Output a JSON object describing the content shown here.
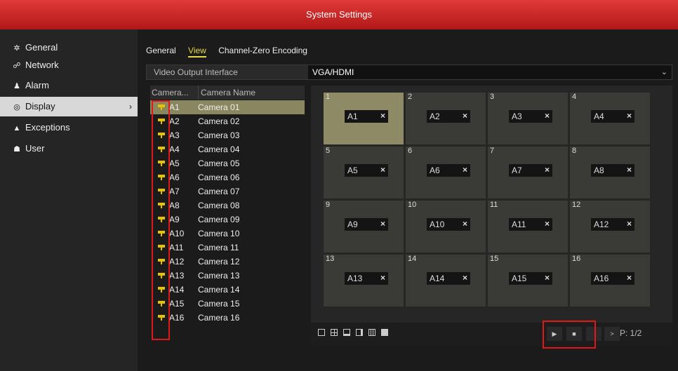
{
  "window": {
    "title": "System Settings"
  },
  "sidebar": {
    "items": [
      {
        "label": "General",
        "icon": "gear-icon"
      },
      {
        "label": "Network",
        "icon": "network-icon"
      },
      {
        "label": "Alarm",
        "icon": "alarm-icon"
      },
      {
        "label": "Display",
        "icon": "eye-icon",
        "active": true
      },
      {
        "label": "Exceptions",
        "icon": "warning-icon"
      },
      {
        "label": "User",
        "icon": "users-icon"
      }
    ]
  },
  "tabs": [
    {
      "label": "General"
    },
    {
      "label": "View",
      "active": true
    },
    {
      "label": "Channel-Zero Encoding"
    }
  ],
  "video_output": {
    "label": "Video Output Interface",
    "value": "VGA/HDMI"
  },
  "camera_table": {
    "headers": [
      "Camera...",
      "Camera Name"
    ],
    "rows": [
      {
        "id": "A1",
        "name": "Camera 01"
      },
      {
        "id": "A2",
        "name": "Camera 02"
      },
      {
        "id": "A3",
        "name": "Camera 03"
      },
      {
        "id": "A4",
        "name": "Camera 04"
      },
      {
        "id": "A5",
        "name": "Camera 05"
      },
      {
        "id": "A6",
        "name": "Camera 06"
      },
      {
        "id": "A7",
        "name": "Camera 07"
      },
      {
        "id": "A8",
        "name": "Camera 08"
      },
      {
        "id": "A9",
        "name": "Camera 09"
      },
      {
        "id": "A10",
        "name": "Camera 10"
      },
      {
        "id": "A11",
        "name": "Camera 11"
      },
      {
        "id": "A12",
        "name": "Camera 12"
      },
      {
        "id": "A13",
        "name": "Camera 13"
      },
      {
        "id": "A14",
        "name": "Camera 14"
      },
      {
        "id": "A15",
        "name": "Camera 15"
      },
      {
        "id": "A16",
        "name": "Camera 16"
      }
    ]
  },
  "grid": {
    "cells": [
      {
        "num": "1",
        "cam": "A1"
      },
      {
        "num": "2",
        "cam": "A2"
      },
      {
        "num": "3",
        "cam": "A3"
      },
      {
        "num": "4",
        "cam": "A4"
      },
      {
        "num": "5",
        "cam": "A5"
      },
      {
        "num": "6",
        "cam": "A6"
      },
      {
        "num": "7",
        "cam": "A7"
      },
      {
        "num": "8",
        "cam": "A8"
      },
      {
        "num": "9",
        "cam": "A9"
      },
      {
        "num": "10",
        "cam": "A10"
      },
      {
        "num": "11",
        "cam": "A11"
      },
      {
        "num": "12",
        "cam": "A12"
      },
      {
        "num": "13",
        "cam": "A13"
      },
      {
        "num": "14",
        "cam": "A14"
      },
      {
        "num": "15",
        "cam": "A15"
      },
      {
        "num": "16",
        "cam": "A16"
      }
    ],
    "close_glyph": "×"
  },
  "layout_buttons": [
    {
      "icon": "layout-1x1-icon"
    },
    {
      "icon": "layout-2x2-icon"
    },
    {
      "icon": "layout-1plus5-icon"
    },
    {
      "icon": "layout-1plus7-icon"
    },
    {
      "icon": "layout-3x3-icon"
    },
    {
      "icon": "layout-4x4-icon"
    }
  ],
  "playback": {
    "play": "▶",
    "stop": "■",
    "next": ">",
    "page": "P: 1/2"
  },
  "colors": {
    "accent_red": "#c41e1e",
    "active_tab": "#e8d84a",
    "camera_icon": "#e8c200",
    "selection": "#8e8a66"
  }
}
